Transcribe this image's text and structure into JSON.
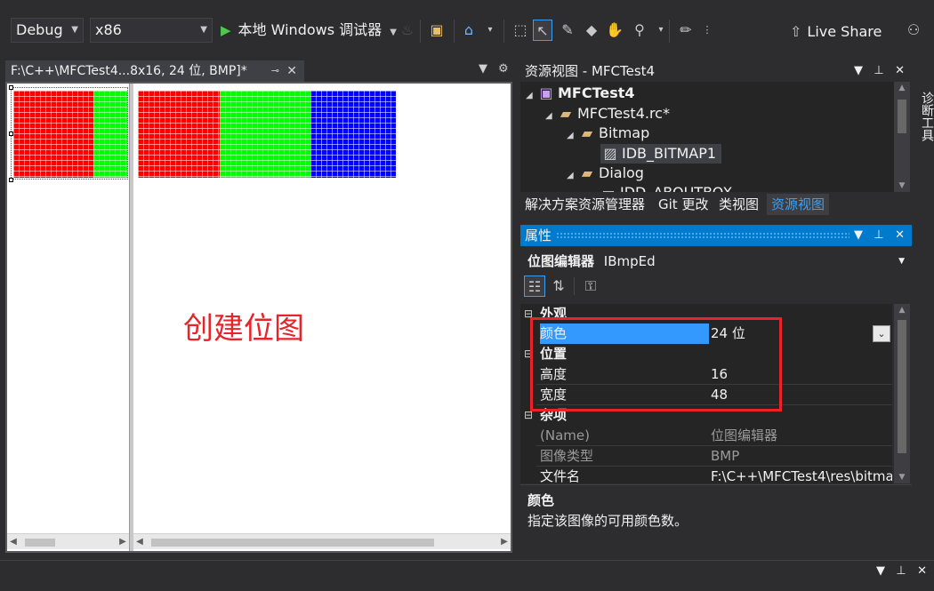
{
  "toolbar": {
    "config": "Debug",
    "platform": "x86",
    "run_label": "本地 Windows 调试器",
    "live_share": "Live Share"
  },
  "document": {
    "tab_title": "F:\\C++\\MFCTest4...8x16, 24 位, BMP]*",
    "annotation": "创建位图",
    "bitmap_colors": [
      "#ff0000",
      "#00ff00",
      "#0000ff"
    ]
  },
  "resource_view": {
    "title": "资源视图 - MFCTest4",
    "tree": [
      {
        "label": "MFCTest4",
        "bold": true
      },
      {
        "label": "MFCTest4.rc*"
      },
      {
        "label": "Bitmap"
      },
      {
        "label": "IDB_BITMAP1"
      },
      {
        "label": "Dialog"
      },
      {
        "label": "IDD_ABOUTBOX"
      }
    ],
    "tabs": [
      "解决方案资源管理器",
      "Git 更改",
      "类视图",
      "资源视图"
    ]
  },
  "properties": {
    "title": "属性",
    "selector_name": "位图编辑器",
    "selector_type": "IBmpEd",
    "rows": [
      {
        "type": "cat",
        "name": "外观"
      },
      {
        "type": "prop",
        "name": "颜色",
        "value": "24 位",
        "selected": true
      },
      {
        "type": "cat",
        "name": "位置"
      },
      {
        "type": "prop",
        "name": "高度",
        "value": "16"
      },
      {
        "type": "prop",
        "name": "宽度",
        "value": "48"
      },
      {
        "type": "cat",
        "name": "杂项"
      },
      {
        "type": "prop",
        "name": "(Name)",
        "value": "位图编辑器",
        "dim": true
      },
      {
        "type": "prop",
        "name": "图像类型",
        "value": "BMP",
        "dim": true
      },
      {
        "type": "prop",
        "name": "文件名",
        "value": "F:\\C++\\MFCTest4\\res\\bitma"
      }
    ],
    "desc_title": "颜色",
    "desc_text": "指定该图像的可用颜色数。"
  },
  "side": {
    "diag_tab": "诊断工具"
  }
}
